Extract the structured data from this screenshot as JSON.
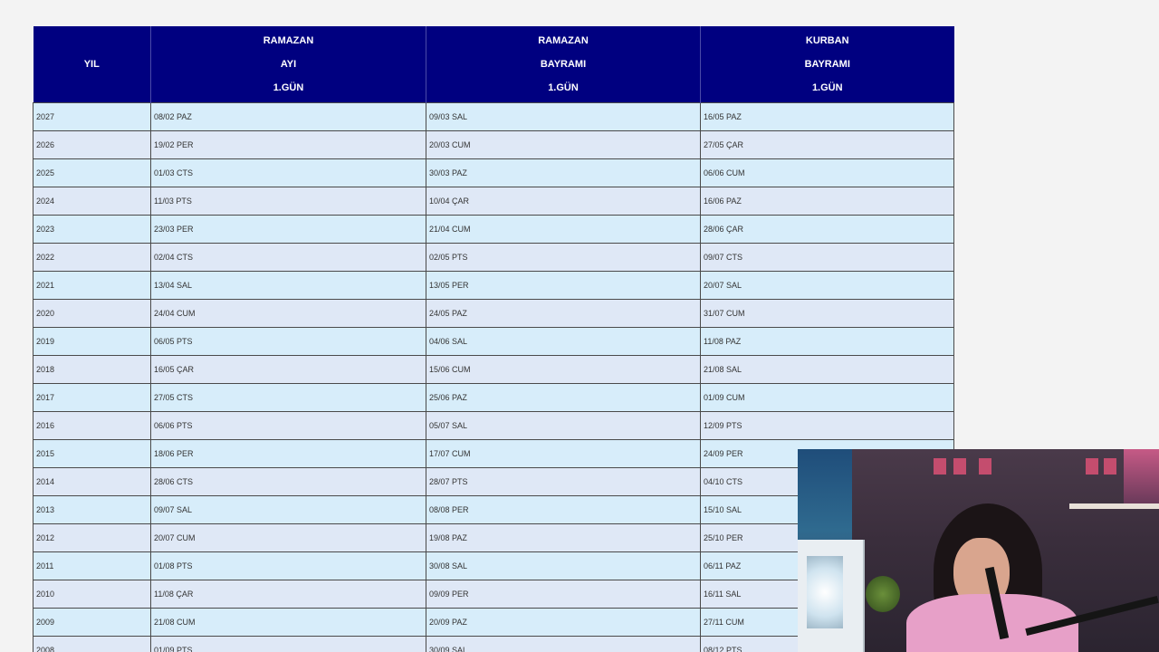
{
  "table": {
    "headers": {
      "year": [
        "YIL"
      ],
      "ramazan": [
        "RAMAZAN",
        "AYI",
        "1.GÜN"
      ],
      "ramazan_bayrami": [
        "RAMAZAN",
        "BAYRAMI",
        "1.GÜN"
      ],
      "kurban_bayrami": [
        "KURBAN",
        "BAYRAMI",
        "1.GÜN"
      ]
    },
    "rows": [
      [
        "2027",
        "08/02 PAZ",
        "09/03 SAL",
        "16/05 PAZ"
      ],
      [
        "2026",
        "19/02 PER",
        "20/03 CUM",
        "27/05 ÇAR"
      ],
      [
        "2025",
        "01/03 CTS",
        "30/03 PAZ",
        "06/06 CUM"
      ],
      [
        "2024",
        "11/03 PTS",
        "10/04 ÇAR",
        "16/06 PAZ"
      ],
      [
        "2023",
        "23/03 PER",
        "21/04 CUM",
        "28/06 ÇAR"
      ],
      [
        "2022",
        "02/04 CTS",
        "02/05 PTS",
        "09/07 CTS"
      ],
      [
        "2021",
        "13/04 SAL",
        "13/05 PER",
        "20/07 SAL"
      ],
      [
        "2020",
        "24/04 CUM",
        "24/05 PAZ",
        "31/07 CUM"
      ],
      [
        "2019",
        "06/05 PTS",
        "04/06 SAL",
        "11/08 PAZ"
      ],
      [
        "2018",
        "16/05 ÇAR",
        "15/06 CUM",
        "21/08 SAL"
      ],
      [
        "2017",
        "27/05 CTS",
        "25/06 PAZ",
        "01/09 CUM"
      ],
      [
        "2016",
        "06/06 PTS",
        "05/07 SAL",
        "12/09 PTS"
      ],
      [
        "2015",
        "18/06 PER",
        "17/07 CUM",
        "24/09 PER"
      ],
      [
        "2014",
        "28/06 CTS",
        "28/07 PTS",
        "04/10 CTS"
      ],
      [
        "2013",
        "09/07 SAL",
        "08/08 PER",
        "15/10 SAL"
      ],
      [
        "2012",
        "20/07 CUM",
        "19/08 PAZ",
        "25/10 PER"
      ],
      [
        "2011",
        "01/08 PTS",
        "30/08 SAL",
        "06/11 PAZ"
      ],
      [
        "2010",
        "11/08 ÇAR",
        "09/09 PER",
        "16/11 SAL"
      ],
      [
        "2009",
        "21/08 CUM",
        "20/09 PAZ",
        "27/11 CUM"
      ],
      [
        "2008",
        "01/09 PTS",
        "30/09 SAL",
        "08/12 PTS"
      ]
    ]
  },
  "colors": {
    "header_bg": "#000080",
    "header_text": "#ffffff",
    "row_bg_odd": "#d7edfa",
    "row_bg_even": "#dfe8f6",
    "page_bg": "#f3f3f3"
  },
  "webcam": {
    "icon": "webcam-overlay"
  }
}
